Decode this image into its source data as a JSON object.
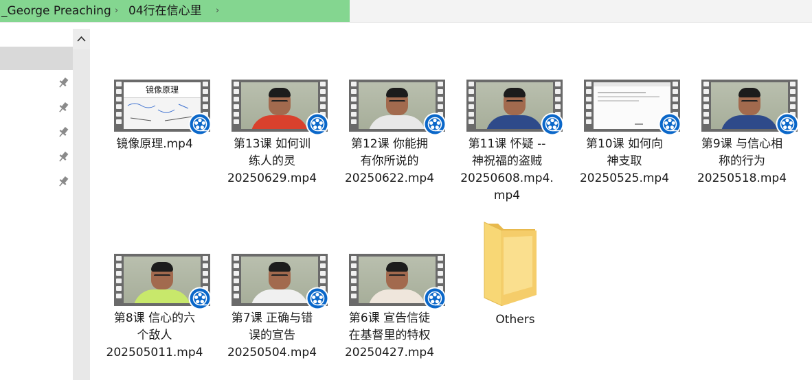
{
  "breadcrumb": {
    "segments": [
      "_George Preaching",
      "04行在信心里"
    ]
  },
  "colors": {
    "address_selected": "#84d690",
    "badge_blue": "#0a67c9",
    "folder": "#f5cd6a"
  },
  "nav": {
    "pinned_count": 5
  },
  "files": [
    {
      "lines": [
        "镜像原理.mp4"
      ],
      "thumb": "board"
    },
    {
      "lines": [
        "第13课 如何训",
        "练人的灵",
        "20250629.mp4"
      ],
      "thumb": "video",
      "shirt": "#d9412d"
    },
    {
      "lines": [
        "第12课 你能拥",
        "有你所说的",
        "20250622.mp4"
      ],
      "thumb": "video",
      "shirt": "#e8e8e8"
    },
    {
      "lines": [
        "第11课 怀疑 --",
        "神祝福的盗贼",
        "20250608.mp4.",
        "mp4"
      ],
      "thumb": "video",
      "shirt": "#2e4a8a"
    },
    {
      "lines": [
        "第10课 如何向",
        "神支取",
        "20250525.mp4"
      ],
      "thumb": "doc"
    },
    {
      "lines": [
        "第9课 与信心相",
        "称的行为",
        "20250518.mp4"
      ],
      "thumb": "video",
      "shirt": "#2e4a8a"
    },
    {
      "lines": [
        "第8课 信心的六",
        "个敌人",
        "202505011.mp4"
      ],
      "thumb": "video",
      "shirt": "#c8e86b"
    },
    {
      "lines": [
        "第7课 正确与错",
        "误的宣告",
        "20250504.mp4"
      ],
      "thumb": "video",
      "shirt": "#f0f0f0"
    },
    {
      "lines": [
        "第6课 宣告信徒",
        "在基督里的特权",
        "20250427.mp4"
      ],
      "thumb": "video",
      "shirt": "#efe6dc"
    }
  ],
  "board_title": "镜像原理",
  "folder": {
    "label": "Others"
  }
}
